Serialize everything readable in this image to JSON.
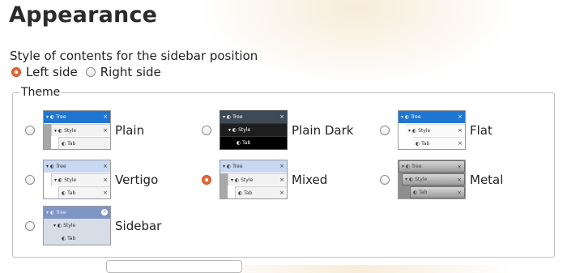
{
  "header": {
    "title": "Appearance"
  },
  "position": {
    "description": "Style of contents for the sidebar position",
    "options": [
      {
        "label": "Left side",
        "selected": true
      },
      {
        "label": "Right side",
        "selected": false
      }
    ]
  },
  "theme": {
    "legend": "Theme",
    "preview": {
      "row1": "Tree",
      "row2": "Style",
      "row3": "Tab",
      "close": "×"
    },
    "options": [
      {
        "name": "Plain",
        "selected": false
      },
      {
        "name": "Plain Dark",
        "selected": false
      },
      {
        "name": "Flat",
        "selected": false
      },
      {
        "name": "Vertigo",
        "selected": false
      },
      {
        "name": "Mixed",
        "selected": true
      },
      {
        "name": "Metal",
        "selected": false
      },
      {
        "name": "Sidebar",
        "selected": false
      }
    ]
  },
  "colors": {
    "accent": "#e66a3a",
    "tab_blue": "#1f76d2"
  }
}
